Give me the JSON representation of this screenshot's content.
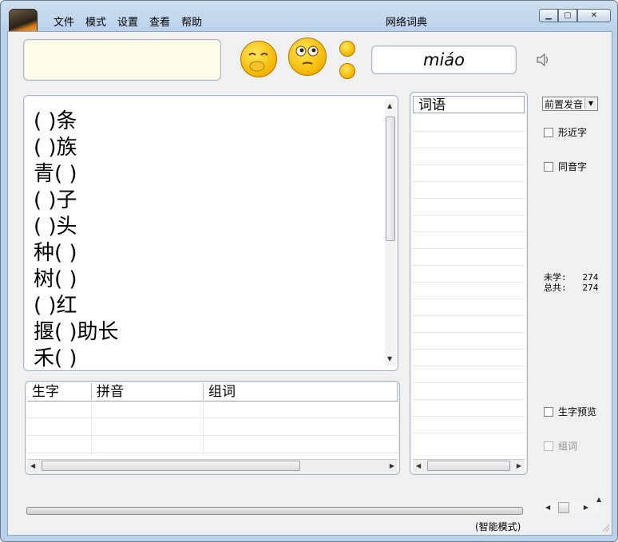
{
  "window": {
    "title": "网络词典"
  },
  "menu": [
    {
      "label": "文件"
    },
    {
      "label": "模式"
    },
    {
      "label": "设置"
    },
    {
      "label": "查看"
    },
    {
      "label": "帮助"
    }
  ],
  "character_input": {
    "value": ""
  },
  "pinyin": "miáo",
  "char_list": [
    "(  )条",
    "(  )族",
    "青(  )",
    "(  )子",
    "(  )头",
    "种(  )",
    "树(  )",
    "(  )红",
    "揠(  )助长",
    "禾(  )"
  ],
  "table": {
    "headers": [
      "生字",
      "拼音",
      "组词"
    ],
    "rows": []
  },
  "words_panel": {
    "header": "词语",
    "items": []
  },
  "pronunciation_select": {
    "selected": "前置发音"
  },
  "checkboxes": {
    "similar": "形近字",
    "homophone": "同音字",
    "preview": "生字预览",
    "group": "组词"
  },
  "stats": {
    "unlearned_label": "未学:",
    "unlearned": "274",
    "total_label": "总共:",
    "total": "274"
  },
  "status": {
    "mode": "(智能模式)"
  },
  "icons": [
    "app-logo-icon",
    "laugh-emoji-icon",
    "think-emoji-icon",
    "small-smile-icon",
    "small-surprised-icon",
    "speaker-icon"
  ]
}
